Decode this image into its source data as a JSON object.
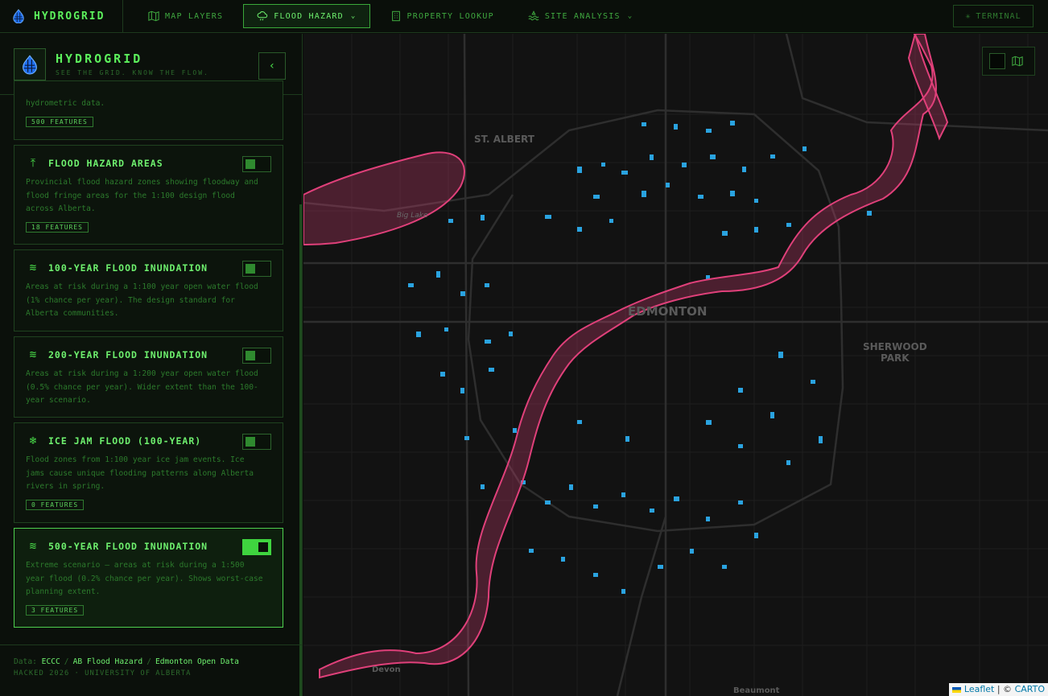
{
  "app": {
    "brand": "HYDROGRID",
    "tagline": "SEE THE GRID. KNOW THE FLOW."
  },
  "nav": {
    "items": [
      {
        "label": "MAP LAYERS",
        "icon": "map-icon"
      },
      {
        "label": "FLOOD HAZARD",
        "icon": "cloud-rain-icon",
        "active": true,
        "dropdown": true
      },
      {
        "label": "PROPERTY LOOKUP",
        "icon": "building-icon"
      },
      {
        "label": "SITE ANALYSIS",
        "icon": "waves-icon",
        "dropdown": true
      }
    ],
    "terminal_label": "TERMINAL"
  },
  "layers": [
    {
      "title": "",
      "desc": "hydrometric data.",
      "badge": "500 FEATURES",
      "enabled": false,
      "partial": true
    },
    {
      "title": "FLOOD HAZARD AREAS",
      "icon": "upload-icon",
      "desc": "Provincial flood hazard zones showing floodway and flood fringe areas for the 1:100 design flood across Alberta.",
      "badge": "18 FEATURES",
      "enabled": false
    },
    {
      "title": "100-YEAR FLOOD INUNDATION",
      "icon": "waves-icon",
      "desc": "Areas at risk during a 1:100 year open water flood (1% chance per year). The design standard for Alberta communities.",
      "badge": "",
      "enabled": false
    },
    {
      "title": "200-YEAR FLOOD INUNDATION",
      "icon": "waves-icon",
      "desc": "Areas at risk during a 1:200 year open water flood (0.5% chance per year). Wider extent than the 100-year scenario.",
      "badge": "",
      "enabled": false
    },
    {
      "title": "ICE JAM FLOOD (100-YEAR)",
      "icon": "snowflake-icon",
      "desc": "Flood zones from 1:100 year ice jam events. Ice jams cause unique flooding patterns along Alberta rivers in spring.",
      "badge": "0 FEATURES",
      "enabled": false
    },
    {
      "title": "500-YEAR FLOOD INUNDATION",
      "icon": "waves-icon",
      "desc": "Extreme scenario — areas at risk during a 1:500 year flood (0.2% chance per year). Shows worst-case planning extent.",
      "badge": "3 FEATURES",
      "enabled": true
    }
  ],
  "footer": {
    "data_prefix": "Data:",
    "sources": [
      "ECCC",
      "AB Flood Hazard",
      "Edmonton Open Data"
    ],
    "credit": "HACKED 2026 · UNIVERSITY OF ALBERTA"
  },
  "map": {
    "labels": {
      "st_albert": "ST. ALBERT",
      "edmonton": "EDMONTON",
      "sherwood": "SHERWOOD",
      "park": "PARK",
      "big_lake": "Big Lake",
      "devon": "Devon",
      "beaumont": "Beaumont"
    },
    "attribution": {
      "leaflet": "Leaflet",
      "sep": " | © ",
      "carto": "CARTO"
    },
    "colors": {
      "flood_zone": "#e0407a",
      "water_bodies": "#2aa3e0",
      "base": "#121212",
      "roads": "#2a2a2a"
    }
  }
}
